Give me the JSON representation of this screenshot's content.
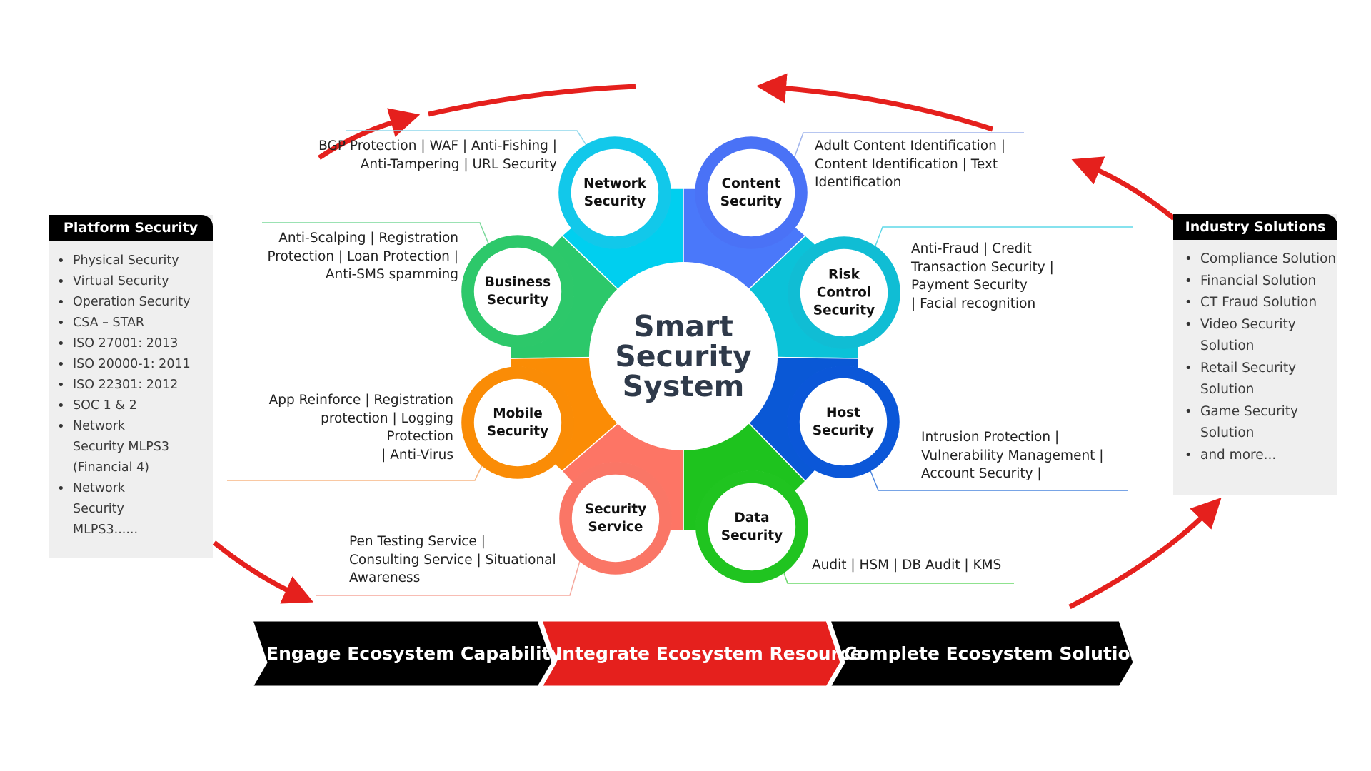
{
  "center": {
    "title": "Smart\nSecurity\nSystem"
  },
  "nodes": [
    {
      "id": "network",
      "label": "Network\nSecurity",
      "color": "#12C8EA",
      "segment_color": "#00CFEF",
      "description": "BGP Protection | WAF | Anti-Fishing |\nAnti-Tampering | URL Security",
      "line_color": "#8FD7EC"
    },
    {
      "id": "content",
      "label": "Content\nSecurity",
      "color": "#4A72F6",
      "segment_color": "#4A78FA",
      "description": "Adult Content Identification |\nContent Identification | Text\nIdentification",
      "line_color": "#9FB3EC"
    },
    {
      "id": "risk",
      "label": "Risk\nControl\nSecurity",
      "color": "#10BDD4",
      "segment_color": "#0BC2D8",
      "description": "Anti-Fraud | Credit\nTransaction Security |\nPayment Security\n| Facial recognition",
      "line_color": "#5ED8E8"
    },
    {
      "id": "host",
      "label": "Host\nSecurity",
      "color": "#0B57D8",
      "segment_color": "#0A58D6",
      "description": "Intrusion Protection |\nVulnerability Management |\nAccount Security |",
      "line_color": "#4C86DE"
    },
    {
      "id": "data",
      "label": "Data\nSecurity",
      "color": "#20C420",
      "segment_color": "#1EC31E",
      "description": "Audit | HSM | DB Audit | KMS",
      "line_color": "#6AD86A"
    },
    {
      "id": "service",
      "label": "Security\nService",
      "color": "#FA7666",
      "segment_color": "#FD7565",
      "description": "Pen Testing Service |\nConsulting Service | Situational\nAwareness",
      "line_color": "#F5A79C"
    },
    {
      "id": "mobile",
      "label": "Mobile\nSecurity",
      "color": "#FA8C06",
      "segment_color": "#FB8C05",
      "description": "App Reinforce | Registration\nprotection | Logging\nProtection\n| Anti-Virus",
      "line_color": "#F7B683"
    },
    {
      "id": "business",
      "label": "Business\nSecurity",
      "color": "#2DC86A",
      "segment_color": "#2CC86A",
      "description": "Anti-Scalping | Registration\nProtection | Loan Protection |\nAnti-SMS spamming",
      "line_color": "#7AD89A"
    }
  ],
  "platform_security": {
    "title": "Platform Security",
    "items": [
      "Physical Security",
      "Virtual Security",
      "Operation Security",
      "CSA – STAR",
      "ISO 27001: 2013",
      "ISO 20000-1: 2011",
      "ISO 22301: 2012",
      "SOC 1 & 2",
      "Network Security MLPS3 (Financial 4)",
      "Network Security MLPS3......"
    ]
  },
  "industry_solutions": {
    "title": "Industry Solutions",
    "items": [
      "Compliance Solution",
      "Financial Solution",
      "CT Fraud Solution",
      "Video Security Solution",
      "Retail Security Solution",
      "Game Security Solution",
      "and more..."
    ]
  },
  "process_steps": [
    {
      "label": "Engage Ecosystem Capability",
      "color": "#000000"
    },
    {
      "label": "Integrate Ecosystem Resource",
      "color": "#E5201D"
    },
    {
      "label": "Complete Ecosystem Solution",
      "color": "#000000"
    }
  ],
  "colors": {
    "arrow": "#E5201D",
    "center_text": "#2F3A4A",
    "panel_bg": "#EFEFEF",
    "panel_header": "#000000"
  }
}
